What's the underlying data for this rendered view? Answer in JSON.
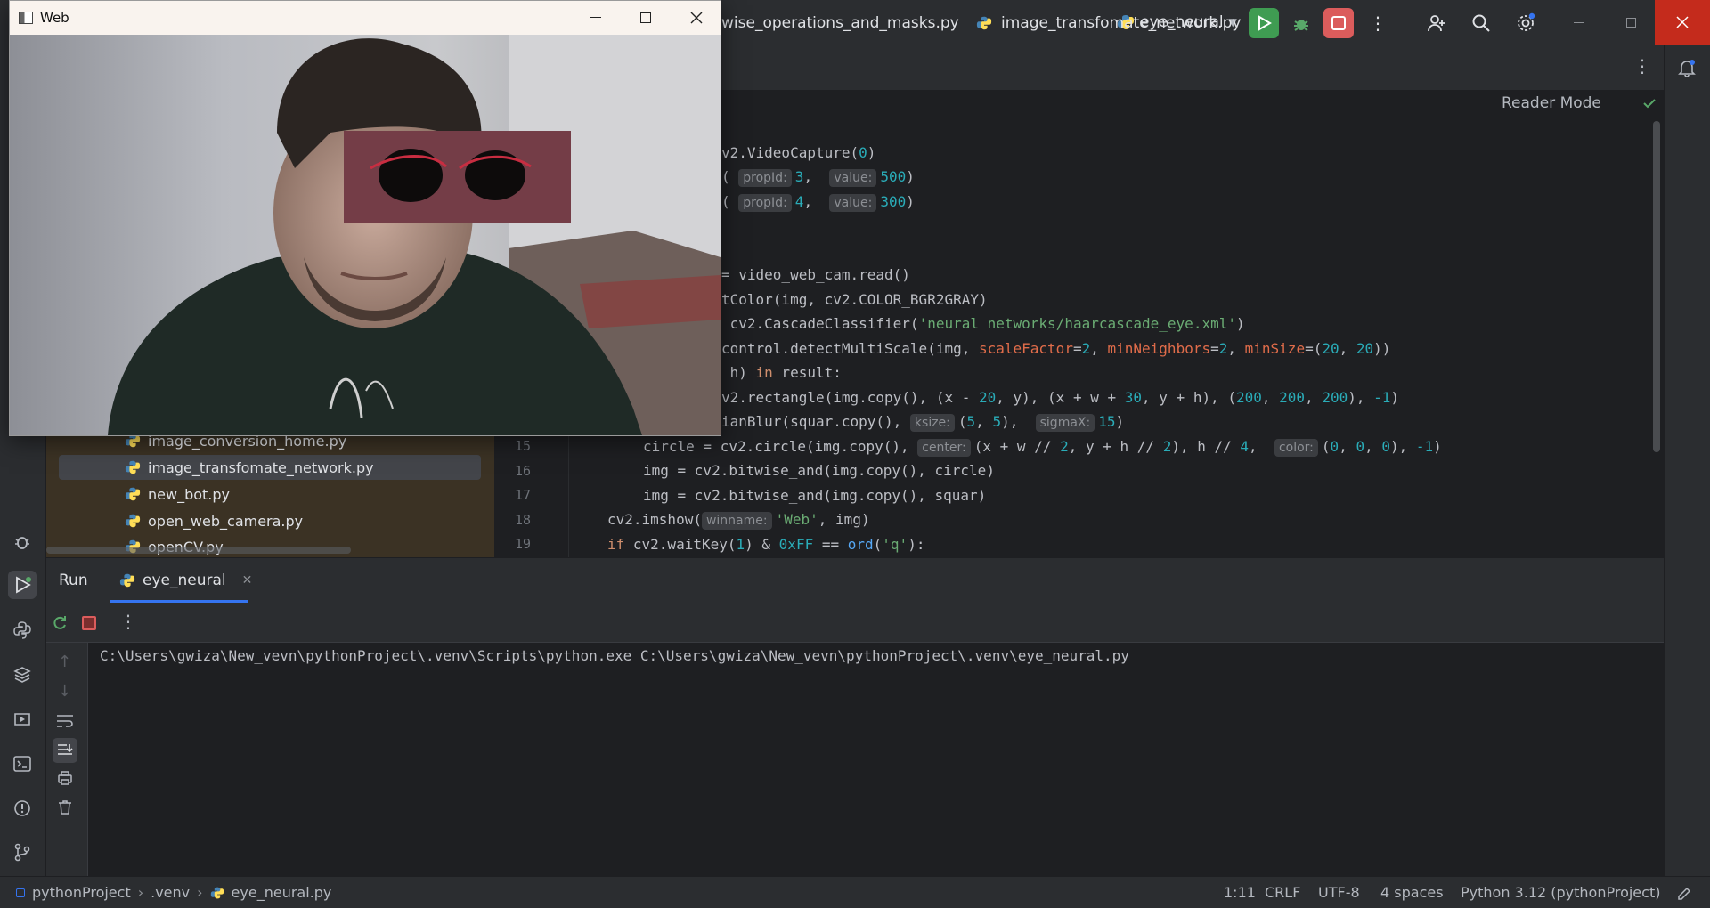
{
  "titlebar": {
    "run_config_name": "eye_neural"
  },
  "editor_tabs": [
    {
      "label": "wise_operations_and_masks.py"
    },
    {
      "label": "image_transfomate_network.py"
    }
  ],
  "editor": {
    "reader_mode": "Reader Mode",
    "line_numbers": [
      "15",
      "16",
      "17",
      "18",
      "19"
    ]
  },
  "code": {
    "l1": "v2.VideoCapture(",
    "l1b": "0",
    "l1c": ")",
    "l2_hint1": "propId:",
    "l2_v1": "3",
    "l2_hint2": "value:",
    "l2_v2": "500",
    "l3_hint1": "propId:",
    "l3_v1": "4",
    "l3_hint2": "value:",
    "l3_v2": "300",
    "l4": "= video_web_cam.read()",
    "l5": "tColor(img, cv2.COLOR_BGR2GRAY)",
    "l6a": " cv2.CascadeClassifier(",
    "l6b": "'neural networks/haarcascade_eye.xml'",
    "l6c": ")",
    "l7a": "control.detectMultiScale(img, ",
    "l7_sf": "scaleFactor",
    "l7_sfv": "2",
    "l7_mn": "minNeighbors",
    "l7_mnv": "2",
    "l7_ms": "minSize",
    "l7_msv1": "20",
    "l7_msv2": "20",
    "l8a": " h) ",
    "l8_in": "in",
    "l8b": " result:",
    "l9a": "v2.rectangle(img.copy(), (x - ",
    "l9_n1": "20",
    "l9b": ", y), (x + w + ",
    "l9_n2": "30",
    "l9c": ", y + h), (",
    "l9_n3": "200",
    "l9_n4": "200",
    "l9_n5": "200",
    "l9_n6": "-1",
    "l10a": "ianBlur(squar.copy(), ",
    "l10_hint1": "ksize:",
    "l10_v1a": "5",
    "l10_v1b": "5",
    "l10_hint2": "sigmaX:",
    "l10_v2": "15",
    "l11a": "circle = cv2.circle(img.copy(), ",
    "l11_hint1": "center:",
    "l11b": "(x + w // ",
    "l11_n1": "2",
    "l11c": ", y + h // ",
    "l11_n2": "2",
    "l11d": "), h // ",
    "l11_n3": "4",
    "l11_hint2": "color:",
    "l11_n4": "0",
    "l11_n5": "0",
    "l11_n6": "0",
    "l11_n7": "-1",
    "l12": "img = cv2.bitwise_and(img.copy(), circle)",
    "l13": "img = cv2.bitwise_and(img.copy(), squar)",
    "l14a": "cv2.imshow(",
    "l14_hint": "winname:",
    "l14_str": "'Web'",
    "l14b": ", img)",
    "l15_if": "if",
    "l15a": " cv2.waitKey(",
    "l15_n1": "1",
    "l15b": ") & ",
    "l15_hex": "0xFF",
    "l15c": " == ",
    "l15_ord": "ord",
    "l15d": "(",
    "l15_str": "'q'",
    "l15e": "):"
  },
  "project_tree": [
    {
      "label": "image_conversion_home.py"
    },
    {
      "label": "image_transfomate_network.py"
    },
    {
      "label": "new_bot.py"
    },
    {
      "label": "open_web_camera.py"
    },
    {
      "label": "openCV.py"
    }
  ],
  "run_panel": {
    "title": "Run",
    "tab_label": "eye_neural",
    "console_output": "C:\\Users\\gwiza\\New_vevn\\pythonProject\\.venv\\Scripts\\python.exe C:\\Users\\gwiza\\New_vevn\\pythonProject\\.venv\\eye_neural.py"
  },
  "web_window": {
    "title": "Web"
  },
  "statusbar": {
    "breadcrumb": [
      "pythonProject",
      ".venv",
      "eye_neural.py"
    ],
    "position": "1:11",
    "line_ending": "CRLF",
    "encoding": "UTF-8",
    "indent": "4 spaces",
    "interpreter": "Python 3.12 (pythonProject)"
  },
  "colors": {
    "run_green": "#3f9c52",
    "stop_red": "#db5c5c",
    "close_red": "#c42b1c",
    "selection": "#43454a"
  }
}
